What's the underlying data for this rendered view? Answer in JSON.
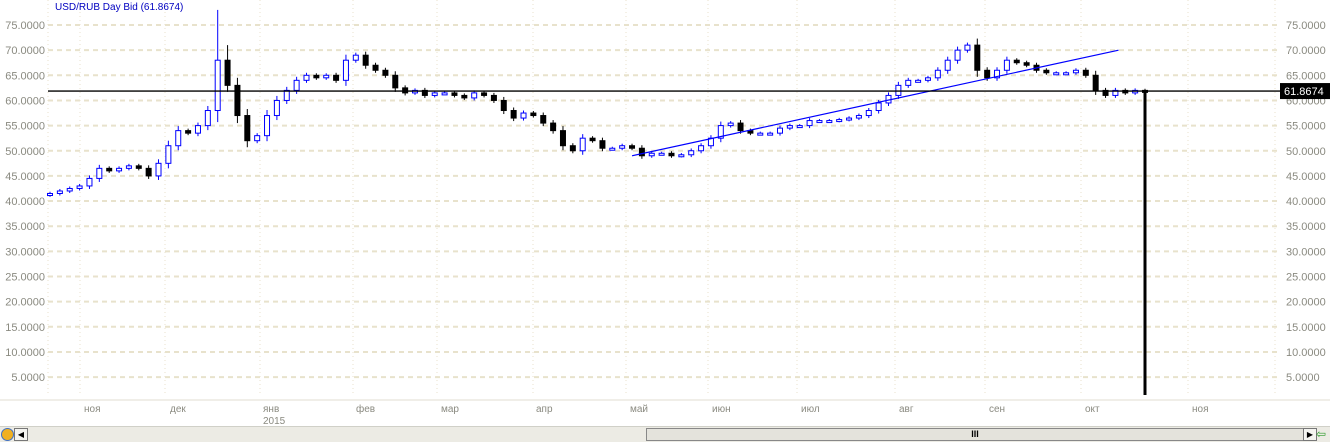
{
  "chart_data": {
    "type": "candlestick",
    "title": "USD/RUB Day Bid (61.8674)",
    "current_value_label": "61.8674",
    "current_value": 61.8674,
    "ylim": [
      0,
      78
    ],
    "y_ticks": [
      "5.0000",
      "10.0000",
      "15.0000",
      "20.0000",
      "25.0000",
      "30.0000",
      "35.0000",
      "40.0000",
      "45.0000",
      "50.0000",
      "55.0000",
      "60.0000",
      "65.0000",
      "70.0000",
      "75.0000"
    ],
    "y_tick_values": [
      5,
      10,
      15,
      20,
      25,
      30,
      35,
      40,
      45,
      50,
      55,
      60,
      65,
      70,
      75
    ],
    "x_ticks": [
      "ноя",
      "дек",
      "янв",
      "фев",
      "мар",
      "апр",
      "май",
      "июн",
      "июл",
      "авг",
      "сен",
      "окт",
      "ноя"
    ],
    "year_label": "2015",
    "grid": true,
    "colors": {
      "up": "#0000ff",
      "down": "#000000",
      "trendline": "#0000ff",
      "grid": "#e8e2cc"
    },
    "closes": [
      41.5,
      42,
      42.5,
      43,
      44.5,
      46.5,
      46,
      46.5,
      47,
      46.5,
      45,
      47.5,
      51,
      54,
      53.5,
      55,
      58,
      68,
      63,
      57,
      52,
      53,
      57,
      60,
      62,
      64,
      65,
      64.5,
      65,
      64,
      68,
      69,
      67,
      66,
      65,
      62.5,
      61.5,
      62,
      61,
      61.5,
      61.5,
      61,
      60.5,
      61.5,
      61,
      60,
      58,
      56.5,
      57.5,
      57,
      55.5,
      54,
      51,
      50,
      52.5,
      52,
      50.5,
      50.5,
      51,
      50.5,
      49,
      49.5,
      49.5,
      49,
      49.2,
      50,
      51,
      52.5,
      55,
      55.5,
      54,
      53.5,
      53.5,
      53.5,
      54.5,
      55,
      55,
      56,
      56,
      56,
      56.2,
      56.5,
      57,
      58,
      59.5,
      61,
      63,
      64,
      64,
      64.5,
      66,
      68,
      70,
      71,
      66,
      64.5,
      66,
      68,
      67.5,
      67,
      66,
      65.5,
      65.5,
      65.5,
      66,
      65,
      62,
      61,
      62,
      61.5,
      62,
      61.8674
    ],
    "spike_highs": [
      {
        "index": 17,
        "high": 78
      },
      {
        "index": 18,
        "high": 71
      }
    ],
    "trendline": {
      "from": {
        "index": 59,
        "value": 49
      },
      "to": {
        "index": 107,
        "value": 70
      }
    }
  },
  "scrollbar": {
    "grip": "III"
  }
}
